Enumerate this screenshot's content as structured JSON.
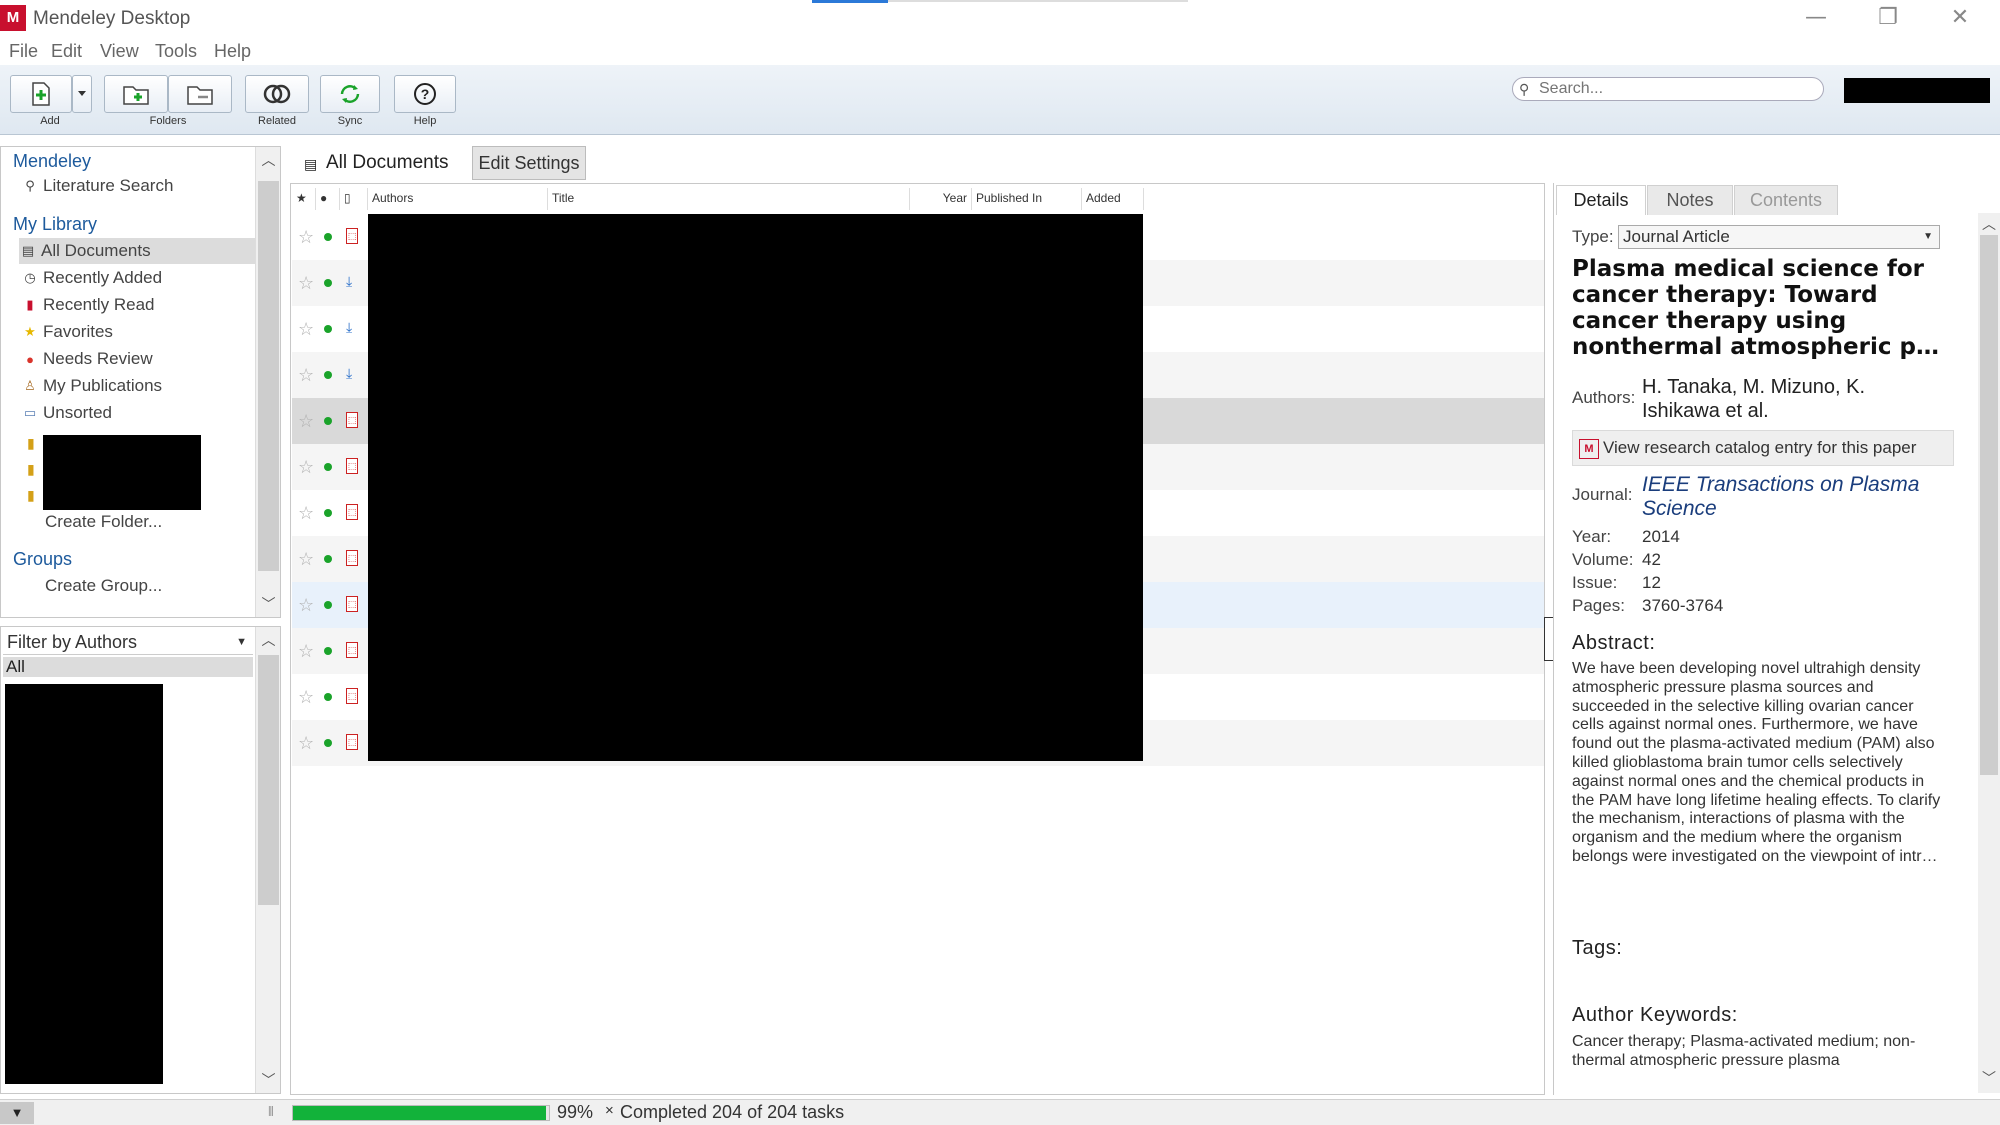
{
  "window": {
    "title": "Mendeley Desktop",
    "logo_text": "M",
    "controls": {
      "minimize": "—",
      "restore": "❐",
      "close": "✕"
    }
  },
  "menu": [
    "File",
    "Edit",
    "View",
    "Tools",
    "Help"
  ],
  "toolbar": {
    "add_label": "Add",
    "folders_label": "Folders",
    "related_label": "Related",
    "sync_label": "Sync",
    "help_label": "Help"
  },
  "search": {
    "placeholder": "Search..."
  },
  "sidebar": {
    "mendeley_header": "Mendeley",
    "literature_search": "Literature Search",
    "library_header": "My Library",
    "items": [
      {
        "label": "All Documents",
        "icon": "all-documents-icon"
      },
      {
        "label": "Recently Added",
        "icon": "clock-icon"
      },
      {
        "label": "Recently Read",
        "icon": "book-icon"
      },
      {
        "label": "Favorites",
        "icon": "star-icon"
      },
      {
        "label": "Needs Review",
        "icon": "question-icon"
      },
      {
        "label": "My Publications",
        "icon": "person-icon"
      },
      {
        "label": "Unsorted",
        "icon": "inbox-icon"
      }
    ],
    "create_folder": "Create Folder...",
    "groups_header": "Groups",
    "create_group": "Create Group..."
  },
  "filter": {
    "selected": "Filter by Authors",
    "all": "All"
  },
  "documents": {
    "header_title": "All Documents",
    "edit_settings": "Edit Settings",
    "columns": [
      "Authors",
      "Title",
      "Year",
      "Published In",
      "Added"
    ],
    "rows": [
      {
        "file": "pdf"
      },
      {
        "file": "download"
      },
      {
        "file": "download"
      },
      {
        "file": "download"
      },
      {
        "file": "pdf"
      },
      {
        "file": "pdf"
      },
      {
        "file": "pdf"
      },
      {
        "file": "pdf"
      },
      {
        "file": "pdf"
      },
      {
        "file": "pdf"
      },
      {
        "file": "pdf"
      },
      {
        "file": "pdf"
      }
    ]
  },
  "details": {
    "tabs": [
      "Details",
      "Notes",
      "Contents"
    ],
    "type_label": "Type:",
    "type_value": "Journal Article",
    "title": "Plasma medical science for cancer therapy: Toward cancer therapy using nonthermal atmospheric p…",
    "authors_label": "Authors:",
    "authors": "H. Tanaka, M. Mizuno, K. Ishikawa et al.",
    "catalog_button": "View research catalog entry for this paper",
    "journal_label": "Journal:",
    "journal": "IEEE Transactions on Plasma Science",
    "year_label": "Year:",
    "year": "2014",
    "volume_label": "Volume:",
    "volume": "42",
    "issue_label": "Issue:",
    "issue": "12",
    "pages_label": "Pages:",
    "pages": "3760-3764",
    "abstract_header": "Abstract:",
    "abstract": "We have been developing novel ultrahigh density atmospheric pressure plasma sources and succeeded in the selective killing ovarian cancer cells against normal ones. Furthermore, we have found out the plasma-activated medium (PAM) also killed glioblastoma brain tumor cells selectively against normal ones and the chemical products in the PAM have long lifetime healing effects. To clarify the mechanism, interactions of plasma with the organism and the medium where the organism belongs were investigated on the viewpoint of intr…",
    "tags_header": "Tags:",
    "keywords_header": "Author Keywords:",
    "keywords": "Cancer therapy; Plasma-activated medium; non-thermal atmospheric pressure plasma"
  },
  "status": {
    "progress_percent": 99,
    "progress_text": "99%",
    "cancel": "×",
    "message": "Completed 204 of 204 tasks"
  }
}
